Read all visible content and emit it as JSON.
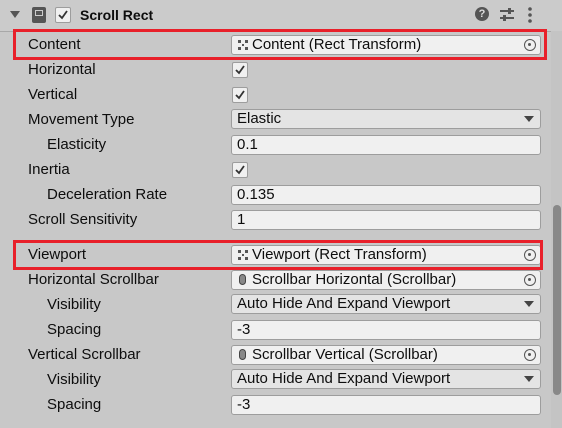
{
  "component": {
    "title": "Scroll Rect",
    "enabled": true
  },
  "properties": {
    "content": {
      "label": "Content",
      "value": "Content (Rect Transform)"
    },
    "horizontal": {
      "label": "Horizontal",
      "checked": true
    },
    "vertical": {
      "label": "Vertical",
      "checked": true
    },
    "movement_type": {
      "label": "Movement Type",
      "value": "Elastic"
    },
    "elasticity": {
      "label": "Elasticity",
      "value": "0.1"
    },
    "inertia": {
      "label": "Inertia",
      "checked": true
    },
    "deceleration_rate": {
      "label": "Deceleration Rate",
      "value": "0.135"
    },
    "scroll_sensitivity": {
      "label": "Scroll Sensitivity",
      "value": "1"
    },
    "viewport": {
      "label": "Viewport",
      "value": "Viewport (Rect Transform)"
    },
    "horizontal_scrollbar": {
      "label": "Horizontal Scrollbar",
      "value": "Scrollbar Horizontal (Scrollbar)"
    },
    "h_visibility": {
      "label": "Visibility",
      "value": "Auto Hide And Expand Viewport"
    },
    "h_spacing": {
      "label": "Spacing",
      "value": "-3"
    },
    "vertical_scrollbar": {
      "label": "Vertical Scrollbar",
      "value": "Scrollbar Vertical (Scrollbar)"
    },
    "v_visibility": {
      "label": "Visibility",
      "value": "Auto Hide And Expand Viewport"
    },
    "v_spacing": {
      "label": "Spacing",
      "value": "-3"
    }
  },
  "colors": {
    "highlight": "#e8202a",
    "panel_bg": "#c8c8c8",
    "field_bg": "#f0f0f0"
  }
}
